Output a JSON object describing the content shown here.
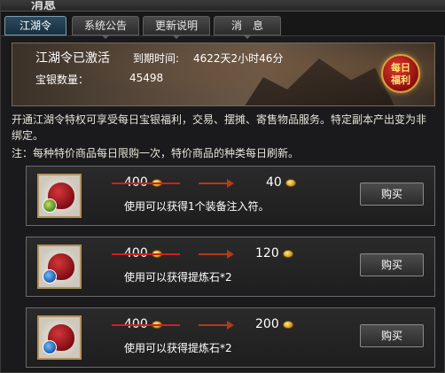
{
  "window": {
    "title": "消息"
  },
  "tabs": [
    {
      "label": "江湖令",
      "active": true
    },
    {
      "label": "系统公告",
      "active": false
    },
    {
      "label": "更新说明",
      "active": false
    },
    {
      "label": "消　息",
      "active": false
    }
  ],
  "banner": {
    "status": "江湖令已激活",
    "expire_label": "到期时间:",
    "expire_value": "4622天2小时46分",
    "silver_label": "宝银数量：",
    "silver_value": "45498",
    "badge_line1": "每日",
    "badge_line2": "福利"
  },
  "description": "开通江湖令特权可享受每日宝银福利，交易、摆摊、寄售物品服务。特定副本产出变为非绑定。",
  "note": "注：每种特价商品每日限购一次，特价商品的种类每日刷新。",
  "items": [
    {
      "old_price": "400",
      "new_price": "40",
      "effect": "使用可以获得1个装备注入符。",
      "buy_label": "购买"
    },
    {
      "old_price": "400",
      "new_price": "120",
      "effect": "使用可以获得提炼石*2",
      "buy_label": "购买"
    },
    {
      "old_price": "400",
      "new_price": "200",
      "effect": "使用可以获得提炼石*2",
      "buy_label": "购买"
    }
  ],
  "colors": {
    "active_tab": "#163040",
    "strike": "#d02020",
    "coin": "#c28a10",
    "badge": "#8a0f0f"
  },
  "icons": {
    "item_thumb": "red-pouch-icon",
    "currency": "gold-ingot-icon",
    "arrow": "right-arrow-icon"
  }
}
